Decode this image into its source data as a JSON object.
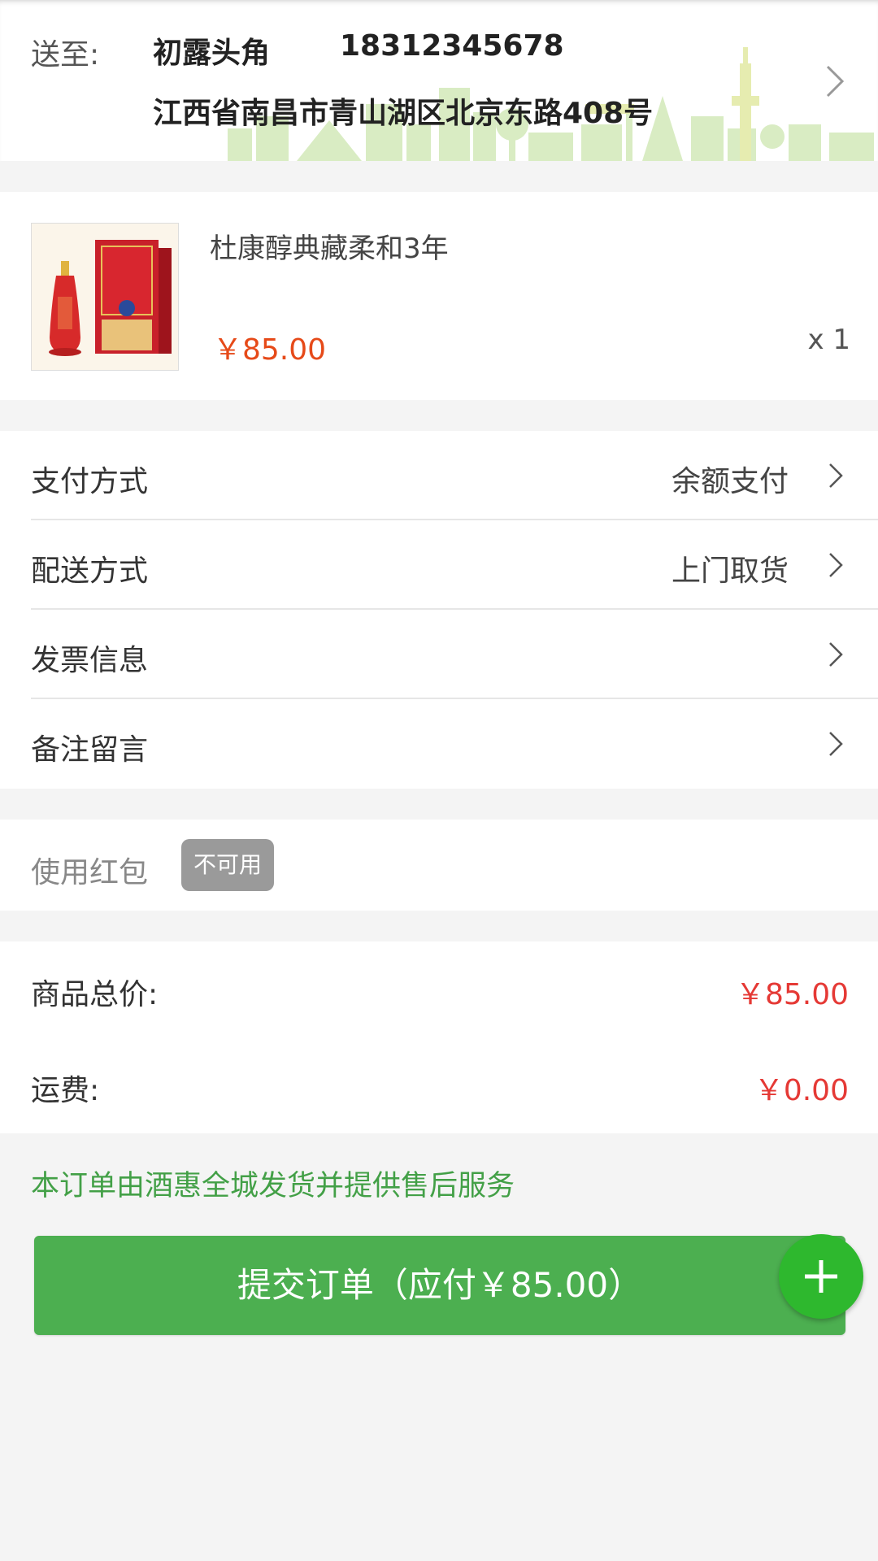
{
  "address": {
    "label": "送至:",
    "name": "初露头角",
    "phone": "18312345678",
    "line": "江西省南昌市青山湖区北京东路408号"
  },
  "product": {
    "name": "杜康醇典藏柔和3年",
    "price": "￥85.00",
    "quantity": "x 1"
  },
  "options": [
    {
      "label": "支付方式",
      "value": "余额支付"
    },
    {
      "label": "配送方式",
      "value": "上门取货"
    },
    {
      "label": "发票信息",
      "value": ""
    },
    {
      "label": "备注留言",
      "value": ""
    }
  ],
  "red_packet": {
    "label": "使用红包",
    "badge": "不可用"
  },
  "totals": {
    "goods_label": "商品总价:",
    "goods_value": "￥85.00",
    "shipping_label": "运费:",
    "shipping_value": "￥0.00"
  },
  "notice": "本订单由酒惠全城发货并提供售后服务",
  "submit_label": "提交订单（应付￥85.00）",
  "colors": {
    "accent_green": "#4caf50",
    "price_red": "#e53935",
    "notice_green": "#43a047"
  },
  "icons": {
    "address_arrow": "chevron-right-icon",
    "row_arrow": "chevron-right-icon",
    "fab": "plus-icon"
  }
}
